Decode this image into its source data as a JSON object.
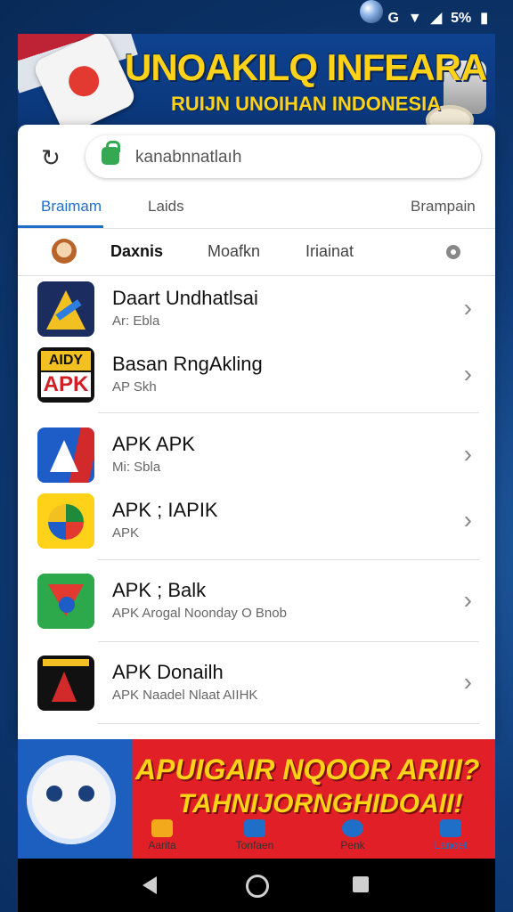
{
  "status_bar": {
    "icons": [
      "G",
      "▼",
      "◢",
      "5%",
      "▮"
    ]
  },
  "banner": {
    "title": "UNOAKILQ INFEARA",
    "subtitle": "RUIJN UNOIHAN INDONESIA"
  },
  "search": {
    "query": "kanabnnatlaıh"
  },
  "tabs": [
    {
      "label": "Braimam",
      "active": true
    },
    {
      "label": "Laids",
      "active": false
    },
    {
      "label": "Brampain",
      "active": false
    }
  ],
  "filters": [
    {
      "label": "Daxnis",
      "active": true
    },
    {
      "label": "Moafkn",
      "active": false
    },
    {
      "label": "Iriainat",
      "active": false
    }
  ],
  "apps": [
    {
      "title": "Daart Undhatlsai",
      "subtitle": "Ar: Ebla",
      "icon": "app-icon-a"
    },
    {
      "title": "Basan RngAkling",
      "subtitle": "AP Skh",
      "icon": "app-icon-apk"
    },
    {
      "title": "APK APK",
      "subtitle": "Mi: Sbla",
      "icon": "app-icon-arrow"
    },
    {
      "title": "APK ; IAPIK",
      "subtitle": "APK",
      "icon": "app-icon-circle"
    },
    {
      "title": "APK ; Balk",
      "subtitle": "APK Arogal Noonday O Bnob",
      "icon": "app-icon-triangle"
    },
    {
      "title": "APK Donailh",
      "subtitle": "APK Naadel Nlaat AIIHK",
      "icon": "app-icon-dark"
    }
  ],
  "promo": {
    "line1": "APUIGAIR NQOOR ARIII?",
    "line2": "TAHNIJORNGHIDOAII!"
  },
  "bottom_nav": [
    {
      "label": "Aarita",
      "icon": "calendar-icon",
      "active": false
    },
    {
      "label": "Tonfaen",
      "icon": "folder-icon",
      "active": false
    },
    {
      "label": "Penk",
      "icon": "pin-icon",
      "active": false
    },
    {
      "label": "Lanoet",
      "icon": "tag-icon",
      "active": true
    }
  ],
  "colors": {
    "accent": "#1f6fc9",
    "banner_text": "#ffd21a",
    "promo_red": "#e01f26",
    "background": "#0f3b78"
  }
}
